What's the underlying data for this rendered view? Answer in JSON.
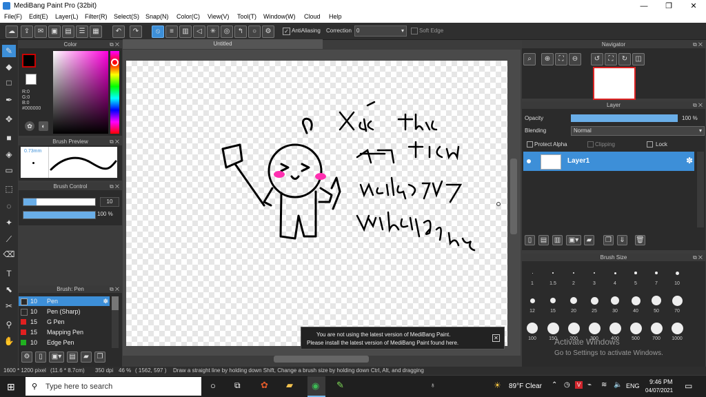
{
  "window": {
    "title": "MediBang Paint Pro (32bit)"
  },
  "menu": [
    "File(F)",
    "Edit(E)",
    "Layer(L)",
    "Filter(R)",
    "Select(S)",
    "Snap(N)",
    "Color(C)",
    "View(V)",
    "Tool(T)",
    "Window(W)",
    "Cloud",
    "Help"
  ],
  "toolbar": {
    "antialias_label": "AntiAliasing",
    "correction_label": "Correction",
    "correction_value": "0",
    "soft_edge_label": "Soft Edge"
  },
  "panels": {
    "color": {
      "title": "Color",
      "r": "R:0",
      "g": "G:0",
      "b": "B:0",
      "hex": "#000000"
    },
    "brush_preview": {
      "title": "Brush Preview",
      "size": "0.73mm"
    },
    "brush_control": {
      "title": "Brush Control",
      "size_value": "10",
      "opacity_value": "100 %"
    },
    "brush_list": {
      "title": "Brush: Pen",
      "items": [
        {
          "size": "10",
          "name": "Pen",
          "color": "#2a2a2a"
        },
        {
          "size": "10",
          "name": "Pen (Sharp)",
          "color": "#2a2a2a"
        },
        {
          "size": "15",
          "name": "G Pen",
          "color": "#e02020"
        },
        {
          "size": "15",
          "name": "Mapping Pen",
          "color": "#e02020"
        },
        {
          "size": "10",
          "name": "Edge Pen",
          "color": "#20b020"
        }
      ]
    },
    "navigator": {
      "title": "Navigator"
    },
    "layer": {
      "title": "Layer",
      "opacity_label": "Opacity",
      "opacity_value": "100 %",
      "blending_label": "Blending",
      "blending_value": "Normal",
      "protect_alpha": "Protect Alpha",
      "clipping": "Clipping",
      "lock": "Lock",
      "layers": [
        {
          "name": "Layer1"
        }
      ]
    },
    "brush_size": {
      "title": "Brush Size",
      "sizes": [
        "1",
        "1.5",
        "2",
        "3",
        "4",
        "5",
        "7",
        "10",
        "12",
        "15",
        "20",
        "25",
        "30",
        "40",
        "50",
        "70",
        "100",
        "150",
        "200",
        "300",
        "400",
        "500",
        "700",
        "1000"
      ]
    }
  },
  "document": {
    "tab": "Untitled"
  },
  "notice": {
    "line1": "You are not using the latest version of MediBang Paint.",
    "line2": "Please install the latest version of MediBang Paint found here."
  },
  "watermark": {
    "line1": "Activate Windows",
    "line2": "Go to Settings to activate Windows."
  },
  "status": {
    "dims": "1600 * 1200 pixel",
    "size": "(11.6 * 8.7cm)",
    "dpi": "350 dpi",
    "zoom": "46 %",
    "coords": "( 1562, 597 )",
    "hint": "Draw a straight line by holding down Shift, Change a brush size by holding down Ctrl, Alt, and dragging"
  },
  "taskbar": {
    "search_placeholder": "Type here to search",
    "weather": "89°F  Clear",
    "lang": "ENG",
    "time": "9:46 PM",
    "date": "04/07/2021"
  },
  "colors": {
    "accent": "#3d8fd8",
    "panel": "#2b2b2b",
    "toolbar": "#2f2f2f"
  }
}
